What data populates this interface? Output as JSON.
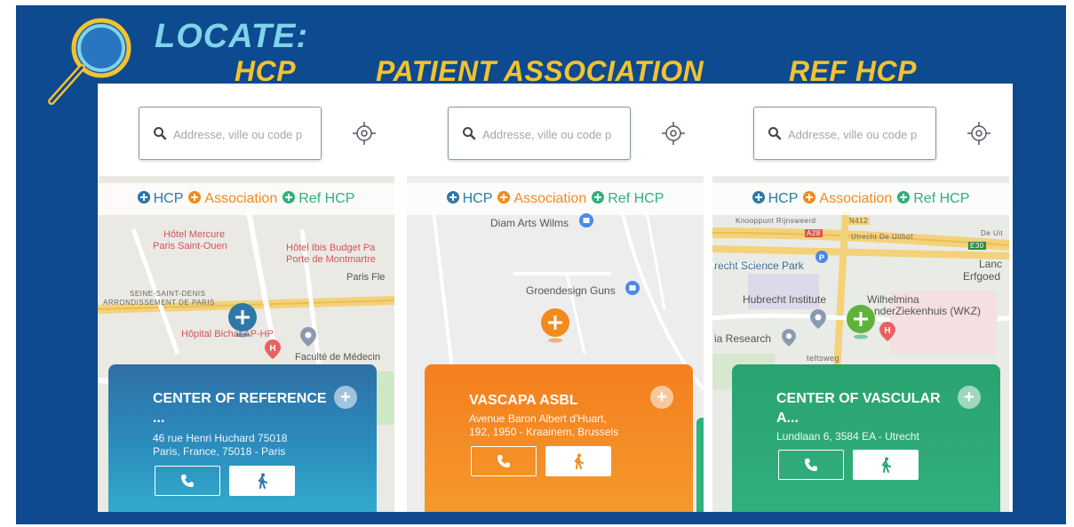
{
  "header": {
    "title": "LOCATE:",
    "columns": [
      "HCP",
      "PATIENT ASSOCIATION",
      "REF HCP"
    ]
  },
  "colors": {
    "background": "#0d4a8f",
    "title": "#7fd3ea",
    "column_title": "#f2c230",
    "hcp": "#2e78a8",
    "association": "#f28a1e",
    "ref_hcp": "#2fb07c"
  },
  "legend": {
    "hcp": "HCP",
    "association": "Association",
    "ref_hcp": "Ref HCP"
  },
  "search": {
    "placeholder": "Addresse, ville ou code p"
  },
  "panels": [
    {
      "map_labels": [
        "Hôtel Mercure",
        "Paris Saint-Ouen",
        "Hôtel Ibis Budget Pa",
        "Porte de Montmartre",
        "Paris Fle",
        "SEINE-SAINT-DENIS",
        "ARRONDISSEMENT DE PARIS",
        "Hôpital Bichat AP-HP",
        "Faculté de Médecin"
      ],
      "card": {
        "title": "CENTER OF REFERENCE",
        "title_more": "...",
        "address_line1": "46 rue Henri Huchard 75018",
        "address_line2": "Paris, France, 75018 - Paris"
      }
    },
    {
      "map_labels": [
        "Diam Arts Wilms",
        "Groendesign Guns"
      ],
      "card": {
        "title": "VASCAPA ASBL",
        "address_line1": "Avenue Baron Albert d'Huart,",
        "address_line2": "192, 1950 - Kraainem, Brussels"
      }
    },
    {
      "map_labels": [
        "Knooppunt Rijnsweerd",
        "N412",
        "A28",
        "Utrecht De Uithof",
        "E30",
        "recht Science Park",
        "Hubrecht Institute",
        "Wilhelmina",
        "nderZiekenhuis (WKZ)",
        "Lanc",
        "Erfgoed",
        "ia Research",
        "teltsweg",
        "De Uit"
      ],
      "card": {
        "title": "CENTER OF VASCULAR",
        "title_more": "A...",
        "address_line1": "Lundlaan 6, 3584 EA - Utrecht"
      }
    }
  ]
}
